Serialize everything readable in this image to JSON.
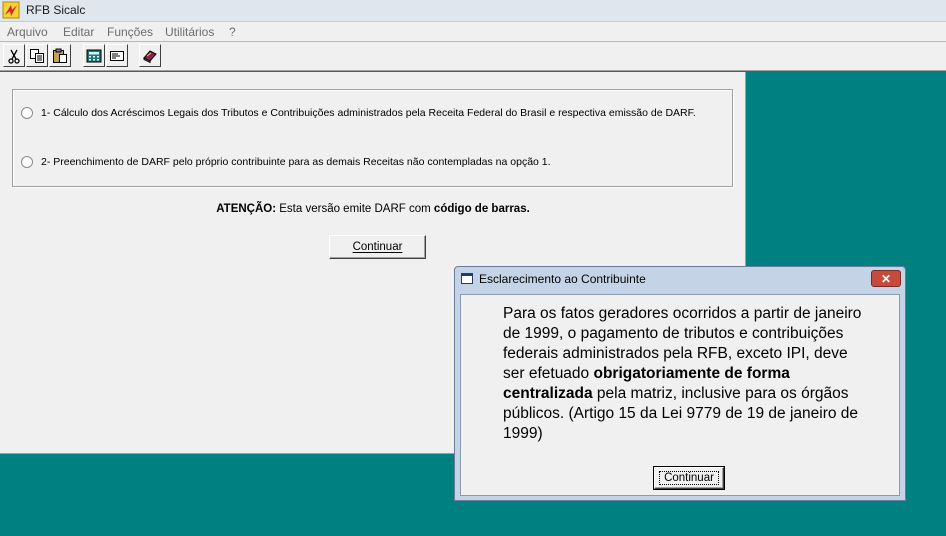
{
  "window": {
    "title": "RFB  Sicalc"
  },
  "menu": [
    "Arquivo",
    "Editar",
    "Funções",
    "Utilitários",
    "?"
  ],
  "toolbar": {
    "buttons": [
      {
        "icon": "scissors-icon"
      },
      {
        "icon": "copy-icon"
      },
      {
        "icon": "paste-icon"
      },
      {
        "icon": "calculator-icon"
      },
      {
        "icon": "form-icon"
      },
      {
        "icon": "book-icon"
      }
    ]
  },
  "main": {
    "option1": "1- Cálculo dos Acréscimos Legais dos Tributos e Contribuições administrados pela Receita Federal do Brasil  e respectiva emissão de DARF.",
    "option2": "2- Preenchimento de DARF pelo próprio contribuinte para as demais Receitas não contempladas na opção 1.",
    "attention_label": "ATENÇÃO:",
    "attention_text": " Esta versão emite DARF com ",
    "attention_bold": "código de barras.",
    "continue_button": "Continuar"
  },
  "dialog": {
    "title": "Esclarecimento ao Contribuinte",
    "text_before": "Para os fatos geradores ocorridos a partir de janeiro de 1999, o pagamento de tributos e contribuições federais administrados pela RFB, exceto IPI, deve ser efetuado ",
    "text_bold": "obrigatoriamente de forma centralizada",
    "text_after": " pela matriz, inclusive para os órgãos públicos. (Artigo 15 da Lei 9779 de 19 de janeiro de 1999)",
    "continue_button": "Continuar",
    "close_symbol": "✕"
  },
  "colors": {
    "desktop": "#008080",
    "close": "#c74b3d",
    "dialog_frame": "#c4d4e6"
  }
}
